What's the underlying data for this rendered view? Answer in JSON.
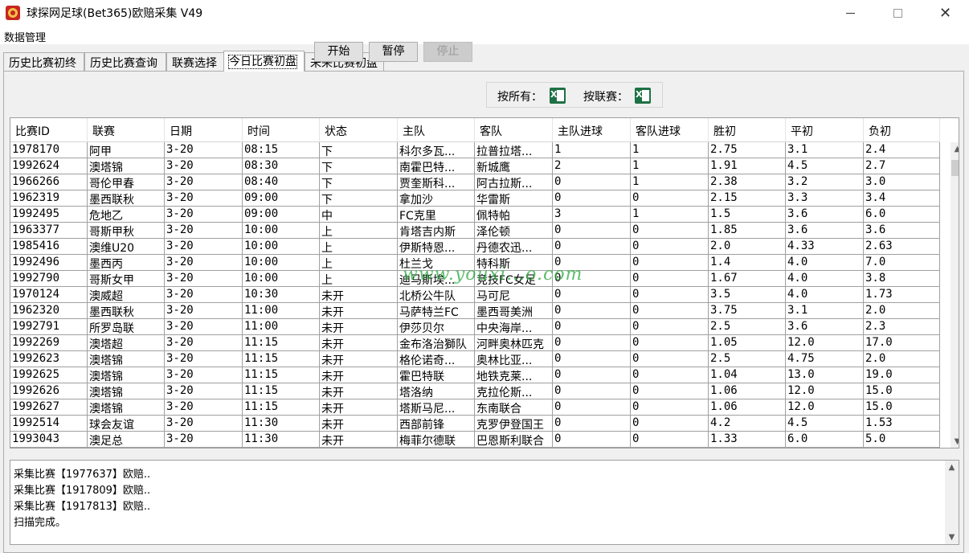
{
  "window": {
    "title": "球探网足球(Bet365)欧赔采集 V49",
    "minimize_icon": "minimize-icon",
    "maximize_icon": "maximize-icon",
    "close_icon": "close-icon"
  },
  "menu": {
    "items": [
      "数据管理"
    ]
  },
  "tabs": [
    {
      "label": "历史比赛初终",
      "active": false
    },
    {
      "label": "历史比赛查询",
      "active": false
    },
    {
      "label": "联赛选择",
      "active": false
    },
    {
      "label": "今日比赛初盘",
      "active": true
    },
    {
      "label": "未来比赛初盘",
      "active": false
    }
  ],
  "toolbar": {
    "start_label": "开始",
    "pause_label": "暂停",
    "stop_label": "停止",
    "export_all_label": "按所有：",
    "export_league_label": "按联赛：",
    "export_icon": "excel-icon"
  },
  "table": {
    "columns": [
      "比赛ID",
      "联赛",
      "日期",
      "时间",
      "状态",
      "主队",
      "客队",
      "主队进球",
      "客队进球",
      "胜初",
      "平初",
      "负初"
    ],
    "rows": [
      [
        "1978170",
        "阿甲",
        "3-20",
        "08:15",
        "下",
        "科尔多瓦...",
        "拉普拉塔...",
        "1",
        "1",
        "2.75",
        "3.1",
        "2.4"
      ],
      [
        "1992624",
        "澳塔锦",
        "3-20",
        "08:30",
        "下",
        "南霍巴特...",
        "新城鹰",
        "2",
        "1",
        "1.91",
        "4.5",
        "2.7"
      ],
      [
        "1966266",
        "哥伦甲春",
        "3-20",
        "08:40",
        "下",
        "贾奎斯科...",
        "阿古拉斯...",
        "0",
        "1",
        "2.38",
        "3.2",
        "3.0"
      ],
      [
        "1962319",
        "墨西联秋",
        "3-20",
        "09:00",
        "下",
        "拿加沙",
        "华雷斯",
        "0",
        "0",
        "2.15",
        "3.3",
        "3.4"
      ],
      [
        "1992495",
        "危地乙",
        "3-20",
        "09:00",
        "中",
        "FC克里",
        "佩特帕",
        "3",
        "1",
        "1.5",
        "3.6",
        "6.0"
      ],
      [
        "1963377",
        "哥斯甲秋",
        "3-20",
        "10:00",
        "上",
        "肯塔吉内斯",
        "泽伦顿",
        "0",
        "0",
        "1.85",
        "3.6",
        "3.6"
      ],
      [
        "1985416",
        "澳维U20",
        "3-20",
        "10:00",
        "上",
        "伊斯特恩...",
        "丹德农迅...",
        "0",
        "0",
        "2.0",
        "4.33",
        "2.63"
      ],
      [
        "1992496",
        "墨西丙",
        "3-20",
        "10:00",
        "上",
        "杜兰戈",
        "特科斯",
        "0",
        "0",
        "1.4",
        "4.0",
        "7.0"
      ],
      [
        "1992790",
        "哥斯女甲",
        "3-20",
        "10:00",
        "上",
        "迪马斯埃...",
        "竞技FC女足",
        "0",
        "0",
        "1.67",
        "4.0",
        "3.8"
      ],
      [
        "1970124",
        "澳威超",
        "3-20",
        "10:30",
        "未开",
        "北桥公牛队",
        "马可尼",
        "0",
        "0",
        "3.5",
        "4.0",
        "1.73"
      ],
      [
        "1962320",
        "墨西联秋",
        "3-20",
        "11:00",
        "未开",
        "马萨特兰FC",
        "墨西哥美洲",
        "0",
        "0",
        "3.75",
        "3.1",
        "2.0"
      ],
      [
        "1992791",
        "所罗岛联",
        "3-20",
        "11:00",
        "未开",
        "伊莎贝尔",
        "中央海岸...",
        "0",
        "0",
        "2.5",
        "3.6",
        "2.3"
      ],
      [
        "1992269",
        "澳塔超",
        "3-20",
        "11:15",
        "未开",
        "金布洛治獅队",
        "河畔奥林匹克",
        "0",
        "0",
        "1.05",
        "12.0",
        "17.0"
      ],
      [
        "1992623",
        "澳塔锦",
        "3-20",
        "11:15",
        "未开",
        "格伦诺奇...",
        "奥林比亚...",
        "0",
        "0",
        "2.5",
        "4.75",
        "2.0"
      ],
      [
        "1992625",
        "澳塔锦",
        "3-20",
        "11:15",
        "未开",
        "霍巴特联",
        "地铁克莱...",
        "0",
        "0",
        "1.04",
        "13.0",
        "19.0"
      ],
      [
        "1992626",
        "澳塔锦",
        "3-20",
        "11:15",
        "未开",
        "塔洛纳",
        "克拉伦斯...",
        "0",
        "0",
        "1.06",
        "12.0",
        "15.0"
      ],
      [
        "1992627",
        "澳塔锦",
        "3-20",
        "11:15",
        "未开",
        "塔斯马尼...",
        "东南联合",
        "0",
        "0",
        "1.06",
        "12.0",
        "15.0"
      ],
      [
        "1992514",
        "球会友谊",
        "3-20",
        "11:30",
        "未开",
        "西部前锋",
        "克罗伊登国王",
        "0",
        "0",
        "4.2",
        "4.5",
        "1.53"
      ],
      [
        "1993043",
        "澳足总",
        "3-20",
        "11:30",
        "未开",
        "梅菲尔德联",
        "巴恩斯利联合",
        "0",
        "0",
        "1.33",
        "6.0",
        "5.0"
      ]
    ]
  },
  "watermark": "www.youxi...o.com",
  "log": {
    "lines": [
      "采集比赛【1977637】欧赔..",
      "采集比赛【1917809】欧赔..",
      "采集比赛【1917813】欧赔..",
      "扫描完成。"
    ]
  }
}
